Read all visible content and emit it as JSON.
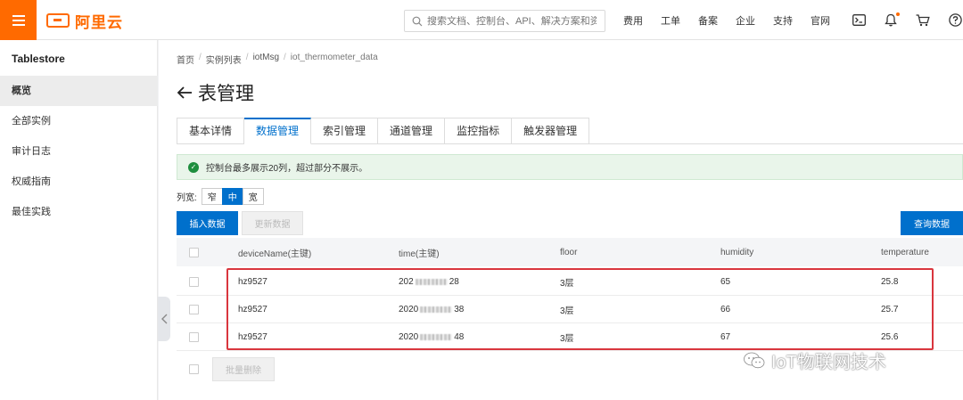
{
  "header": {
    "brand": "阿里云",
    "search_placeholder": "搜索文档、控制台、API、解决方案和资源",
    "links": [
      "费用",
      "工单",
      "备案",
      "企业",
      "支持",
      "官网"
    ]
  },
  "sidebar": {
    "title": "Tablestore",
    "items": [
      {
        "label": "概览",
        "active": true
      },
      {
        "label": "全部实例"
      },
      {
        "label": "审计日志"
      },
      {
        "label": "权威指南"
      },
      {
        "label": "最佳实践"
      }
    ]
  },
  "breadcrumb": [
    "首页",
    "实例列表",
    "iotMsg",
    "iot_thermometer_data"
  ],
  "page": {
    "title": "表管理"
  },
  "tabs": [
    {
      "label": "基本详情"
    },
    {
      "label": "数据管理",
      "active": true
    },
    {
      "label": "索引管理"
    },
    {
      "label": "通道管理"
    },
    {
      "label": "监控指标"
    },
    {
      "label": "触发器管理"
    }
  ],
  "notice": "控制台最多展示20列，超过部分不展示。",
  "colwidth": {
    "label": "列宽:",
    "options": [
      "窄",
      "中",
      "宽"
    ],
    "selected": "中"
  },
  "actions": {
    "insert": "插入数据",
    "update": "更新数据",
    "query": "查询数据",
    "batch_delete": "批量删除"
  },
  "table": {
    "columns": [
      "deviceName(主键)",
      "time(主键)",
      "floor",
      "humidity",
      "temperature"
    ],
    "rows": [
      {
        "deviceName": "hz9527",
        "time_prefix": "202",
        "time_suffix": "28",
        "floor": "3层",
        "humidity": "65",
        "temperature": "25.8"
      },
      {
        "deviceName": "hz9527",
        "time_prefix": "2020",
        "time_suffix": "38",
        "floor": "3层",
        "humidity": "66",
        "temperature": "25.7"
      },
      {
        "deviceName": "hz9527",
        "time_prefix": "2020",
        "time_suffix": "48",
        "floor": "3层",
        "humidity": "67",
        "temperature": "25.6"
      }
    ]
  },
  "watermark": "IoT物联网技术",
  "colors": {
    "brand": "#ff6a00",
    "primary": "#0070cc",
    "highlight": "#d9363e",
    "success": "#1e8e3e"
  },
  "icons": [
    "menu-icon",
    "search-icon",
    "terminal-icon",
    "bell-icon",
    "cart-icon",
    "help-icon",
    "back-arrow-icon",
    "check-circle-icon",
    "chevron-left-icon",
    "wechat-icon"
  ]
}
